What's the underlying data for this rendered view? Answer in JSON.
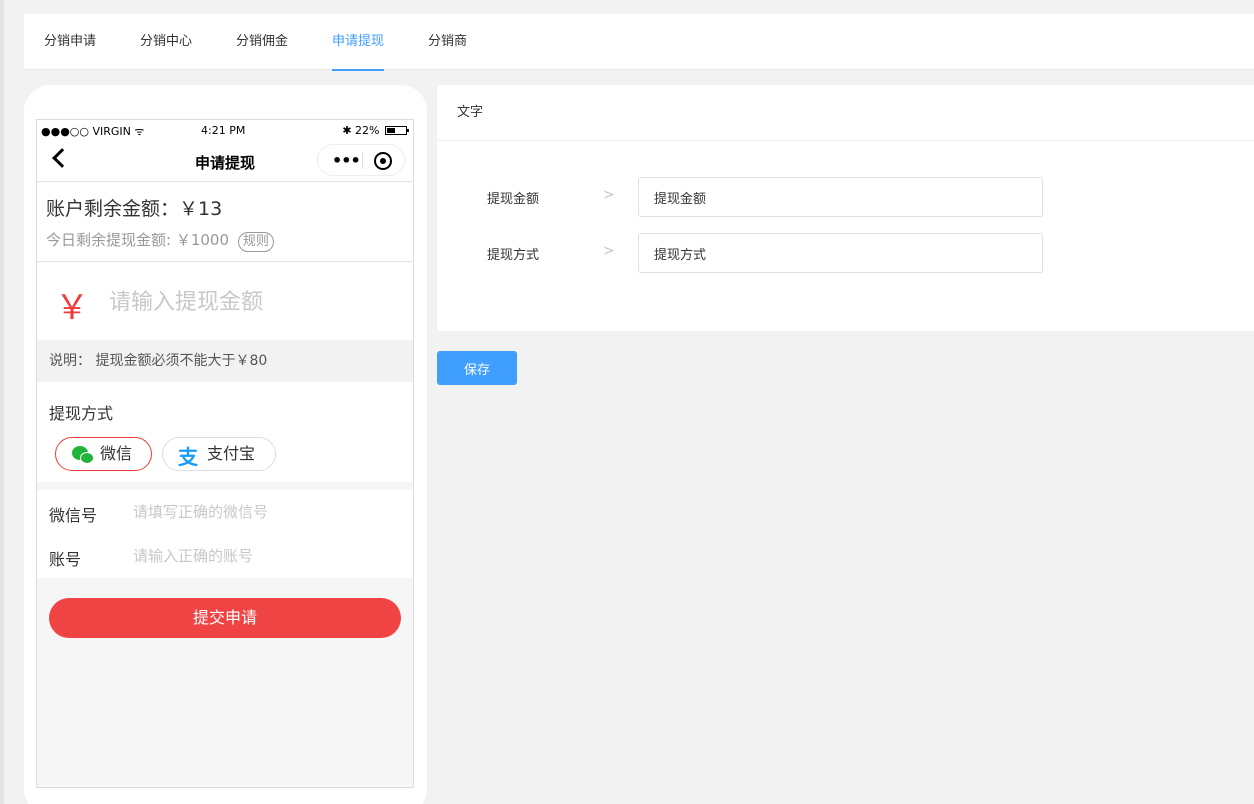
{
  "tabs": [
    {
      "label": "分销申请",
      "active": false
    },
    {
      "label": "分销中心",
      "active": false
    },
    {
      "label": "分销佣金",
      "active": false
    },
    {
      "label": "申请提现",
      "active": true
    },
    {
      "label": "分销商",
      "active": false
    }
  ],
  "phone": {
    "status": {
      "carrier": "●●●○○ VIRGIN",
      "wifi": "ᯤ",
      "time": "4:21 PM",
      "bluetooth": "✱",
      "battery": "22%"
    },
    "nav_title": "申请提现",
    "balance": {
      "label": "账户剩余金额：",
      "value": "￥13"
    },
    "today": {
      "label": "今日剩余提现金额:",
      "value": "￥1000",
      "rule": "规则"
    },
    "amount": {
      "symbol": "￥",
      "placeholder": "请输入提现金额"
    },
    "note": {
      "label": "说明：",
      "text": "提现金额必须不能大于￥80"
    },
    "method": {
      "title": "提现方式",
      "options": [
        {
          "label": "微信",
          "icon": "wechat-icon",
          "selected": true
        },
        {
          "label": "支付宝",
          "icon": "alipay-icon",
          "selected": false
        }
      ]
    },
    "fields": [
      {
        "label": "微信号",
        "placeholder": "请填写正确的微信号"
      },
      {
        "label": "账号",
        "placeholder": "请输入正确的账号"
      }
    ],
    "submit_label": "提交申请"
  },
  "config": {
    "header": "文字",
    "rows": [
      {
        "label": "提现金额",
        "value": "提现金额"
      },
      {
        "label": "提现方式",
        "value": "提现方式"
      }
    ],
    "save_label": "保存"
  },
  "colors": {
    "accent": "#409eff",
    "danger": "#f04444",
    "wechat": "#22b43a",
    "alipay": "#1a9bfc"
  }
}
